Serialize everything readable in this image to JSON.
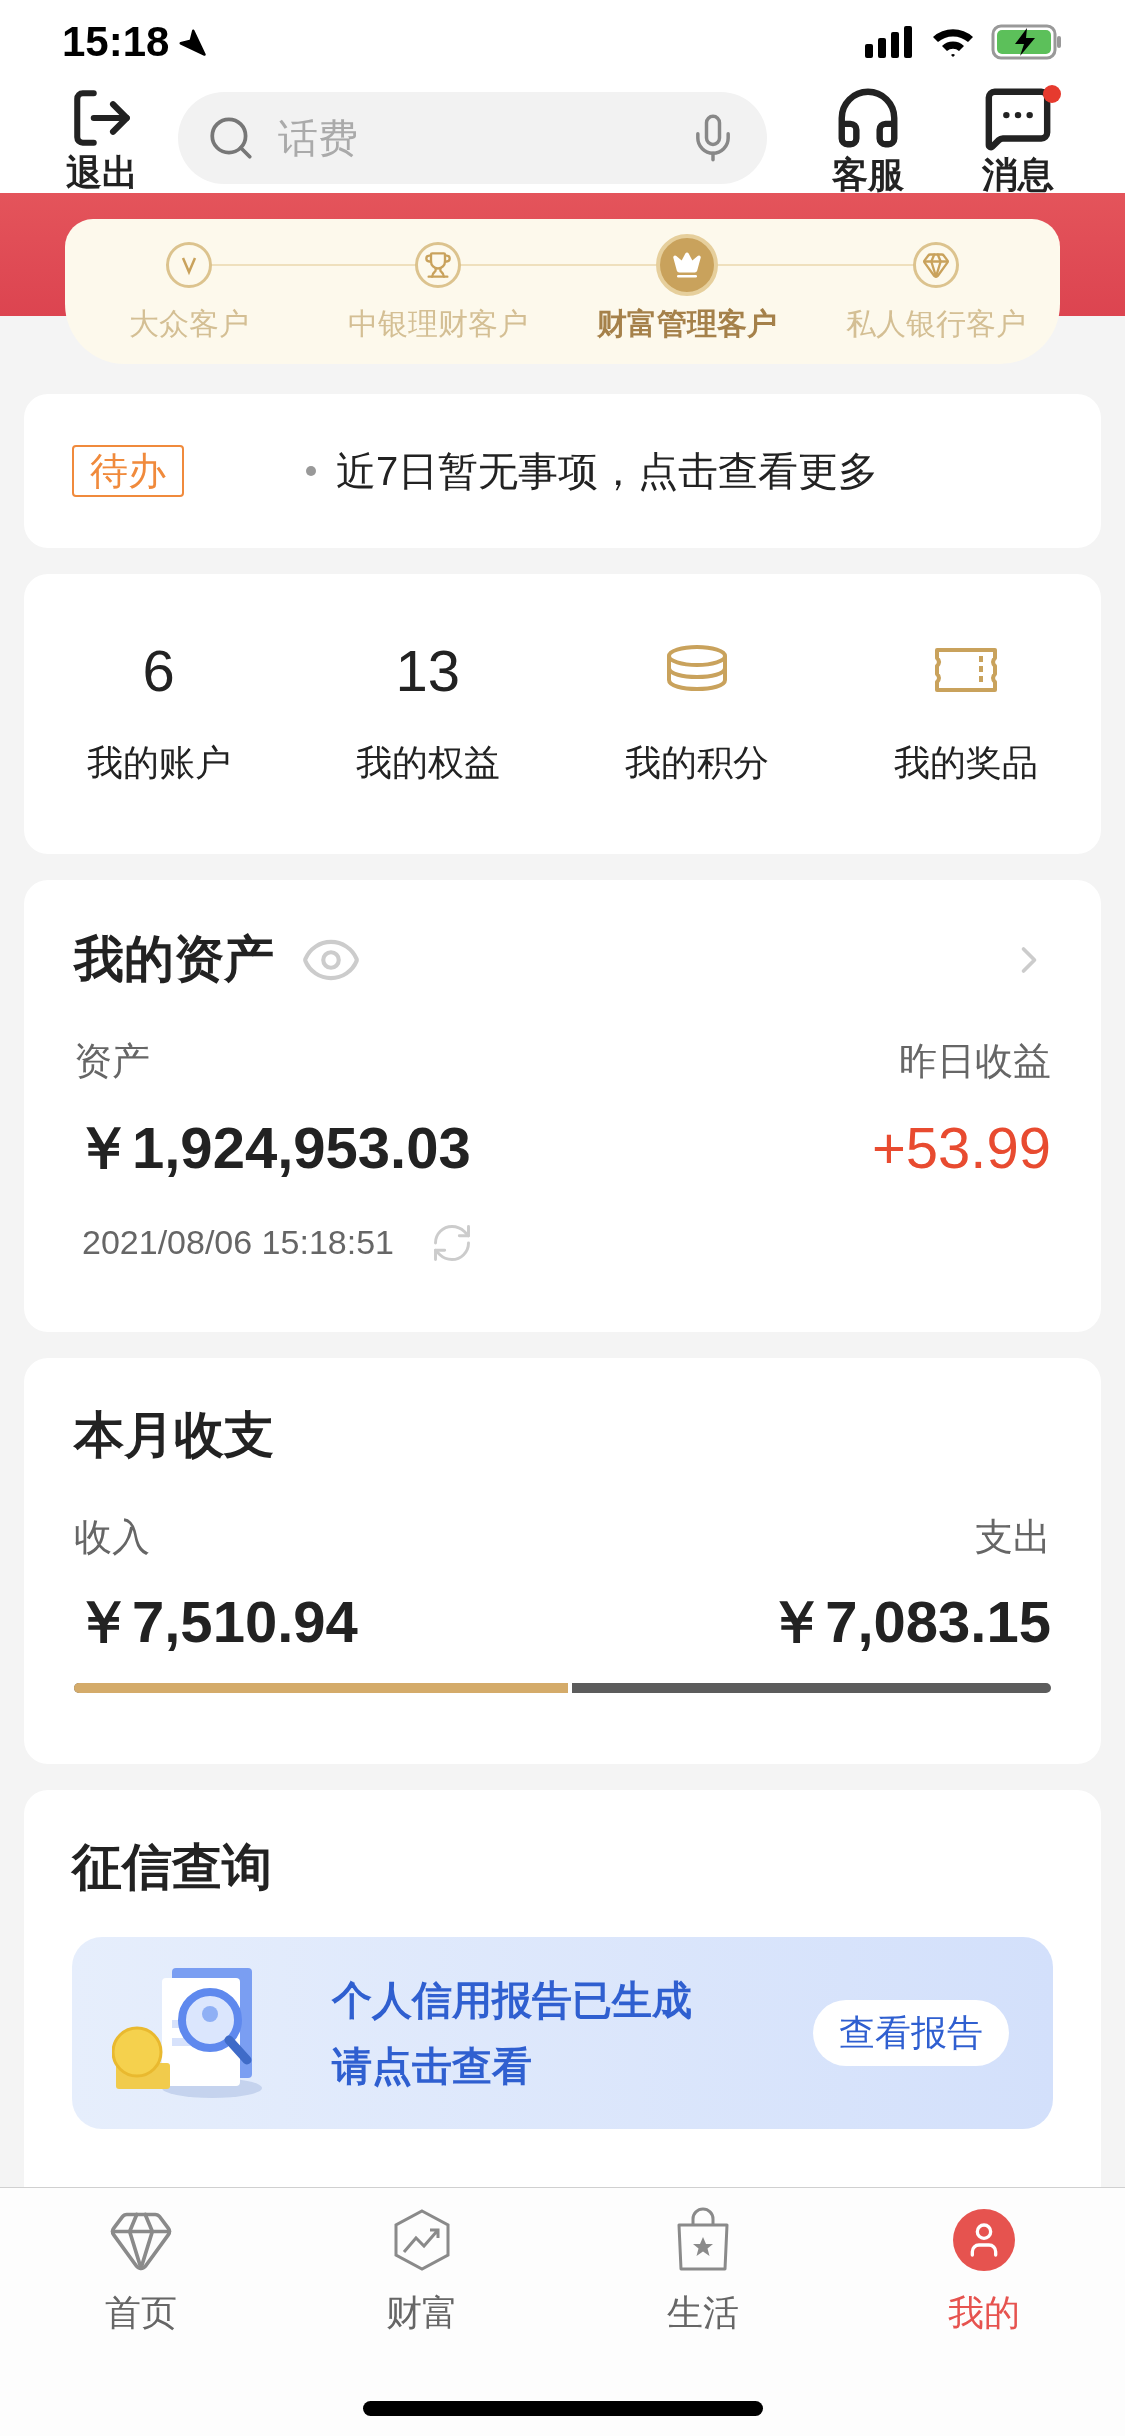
{
  "status_bar": {
    "time": "15:18"
  },
  "header": {
    "exit_label": "退出",
    "search": {
      "placeholder": "话费"
    },
    "service_label": "客服",
    "messages": {
      "label": "消息",
      "unread": true
    }
  },
  "tiers": [
    {
      "label": "大众客户",
      "kind": "v",
      "selected": false
    },
    {
      "label": "中银理财客户",
      "kind": "trophy",
      "selected": false
    },
    {
      "label": "财富管理客户",
      "kind": "crown",
      "selected": true
    },
    {
      "label": "私人银行客户",
      "kind": "diamond",
      "selected": false
    }
  ],
  "todo": {
    "tag": "待办",
    "text": "近7日暂无事项，点击查看更多"
  },
  "stats": [
    {
      "kind": "number",
      "value": "6",
      "label": "我的账户"
    },
    {
      "kind": "number",
      "value": "13",
      "label": "我的权益"
    },
    {
      "kind": "coins",
      "label": "我的积分"
    },
    {
      "kind": "ticket",
      "label": "我的奖品"
    }
  ],
  "assets": {
    "title": "我的资产",
    "asset_label": "资产",
    "asset_value": "￥1,924,953.03",
    "yield_label": "昨日收益",
    "yield_value": "+53.99",
    "updated": "2021/08/06 15:18:51"
  },
  "monthly": {
    "title": "本月收支",
    "income_label": "收入",
    "income_value": "￥7,510.94",
    "expense_label": "支出",
    "expense_value": "￥7,083.15",
    "level": 0.51
  },
  "credit": {
    "title": "征信查询",
    "line_1": "个人信用报告已生成",
    "line_2": "请点击查看",
    "button": "查看报告"
  },
  "tab_bar": [
    {
      "label": "首页",
      "kind": "home",
      "selected": false
    },
    {
      "label": "财富",
      "kind": "wealth",
      "selected": false
    },
    {
      "label": "生活",
      "kind": "life",
      "selected": false
    },
    {
      "label": "我的",
      "kind": "mine",
      "selected": true
    }
  ]
}
